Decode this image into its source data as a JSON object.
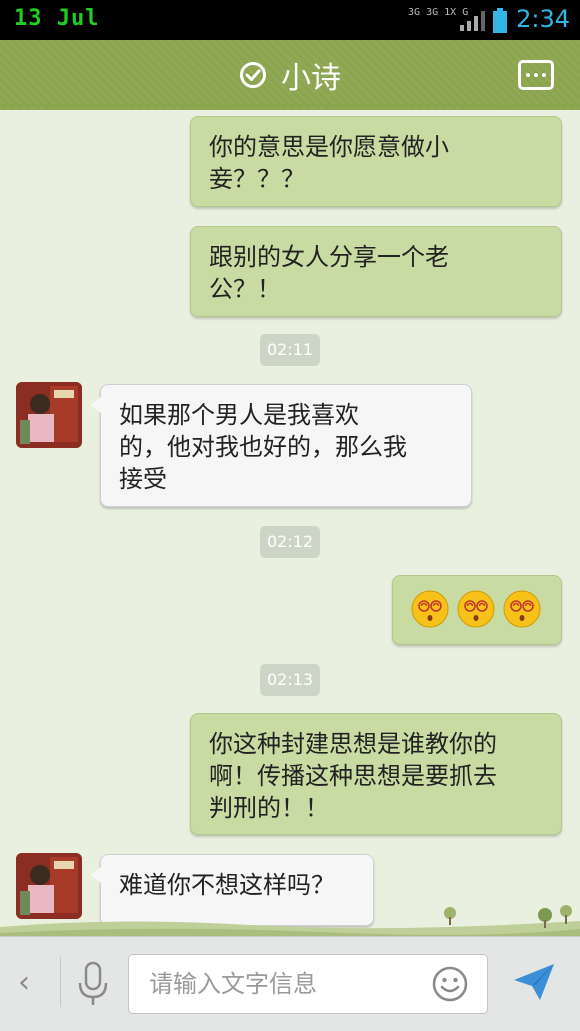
{
  "status_bar": {
    "date": "13 Jul",
    "network_1": "3G",
    "network_2": "3G 1X",
    "network_3": "G",
    "time": "2:34"
  },
  "header": {
    "title": "小诗",
    "icons": [
      "check-circle-icon",
      "more-menu-icon"
    ]
  },
  "chat": {
    "messages": [
      {
        "side": "out",
        "text": "你的意思是你愿意做小妾？？？"
      },
      {
        "side": "out",
        "text": "跟别的女人分享一个老公？！"
      },
      {
        "type": "time",
        "text": "02:11"
      },
      {
        "side": "in",
        "text": "如果那个男人是我喜欢的，他对我也好的，那么我接受"
      },
      {
        "type": "time",
        "text": "02:12"
      },
      {
        "side": "out",
        "emoji": [
          "dizzy-face-emoji",
          "dizzy-face-emoji",
          "dizzy-face-emoji"
        ]
      },
      {
        "type": "time",
        "text": "02:13"
      },
      {
        "side": "out",
        "text": "你这种封建思想是谁教你的啊！传播这种思想是要抓去判刑的！！"
      },
      {
        "side": "in",
        "text": "难道你不想这样吗？"
      }
    ],
    "m1_line1": "你的意思是你愿意做小",
    "m1_line2": "妾？？？",
    "m2_line1": "跟别的女人分享一个老",
    "m2_line2": "公？！",
    "t1": "02:11",
    "m3_line1": "如果那个男人是我喜欢",
    "m3_line2": "的，他对我也好的，那么我",
    "m3_line3": "接受",
    "t2": "02:12",
    "t3": "02:13",
    "m5_line1": "你这种封建思想是谁教你的",
    "m5_line2": "啊！传播这种思想是要抓去",
    "m5_line3": "判刑的！！",
    "m6": "难道你不想这样吗？"
  },
  "input_bar": {
    "placeholder": "请输入文字信息",
    "icons": [
      "back-arrow-icon",
      "microphone-icon",
      "smiley-icon",
      "send-icon"
    ]
  },
  "colors": {
    "header_green": "#8ca54f",
    "outgoing_bubble": "#c8dba2",
    "incoming_bubble": "#f6f6f6",
    "chat_background": "#e9f0df",
    "status_time_blue": "#33b5e5",
    "status_date_green": "#1fd11f"
  }
}
